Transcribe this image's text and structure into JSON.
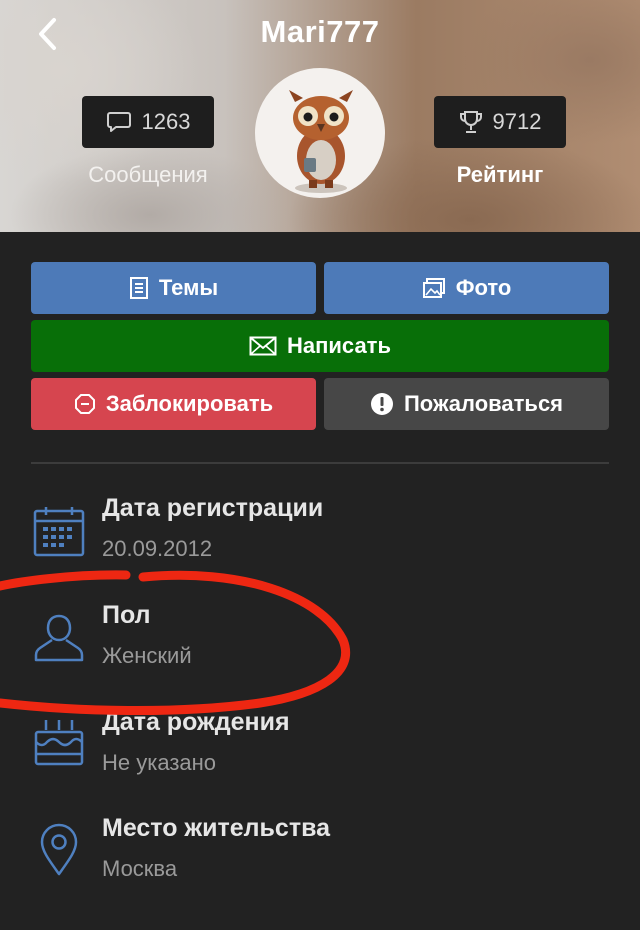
{
  "header": {
    "title": "Mari777",
    "back_icon": "chevron-left-icon",
    "messages_count": "1263",
    "messages_label": "Сообщения",
    "rating_value": "9712",
    "rating_label": "Рейтинг"
  },
  "buttons": {
    "themes": "Темы",
    "photo": "Фото",
    "write": "Написать",
    "block": "Заблокировать",
    "report": "Пожаловаться"
  },
  "info": [
    {
      "title": "Дата регистрации",
      "value": "20.09.2012",
      "icon": "calendar-icon"
    },
    {
      "title": "Пол",
      "value": "Женский",
      "icon": "person-icon"
    },
    {
      "title": "Дата рождения",
      "value": "Не указано",
      "icon": "cake-icon"
    },
    {
      "title": "Место жительства",
      "value": "Москва",
      "icon": "location-pin-icon"
    }
  ],
  "colors": {
    "primary_blue": "#4d7ab8",
    "write_green": "#086f08",
    "block_red": "#d6454f",
    "report_gray": "#474747",
    "annotation_red": "#ee2712",
    "icon_blue": "#4f80c0"
  }
}
